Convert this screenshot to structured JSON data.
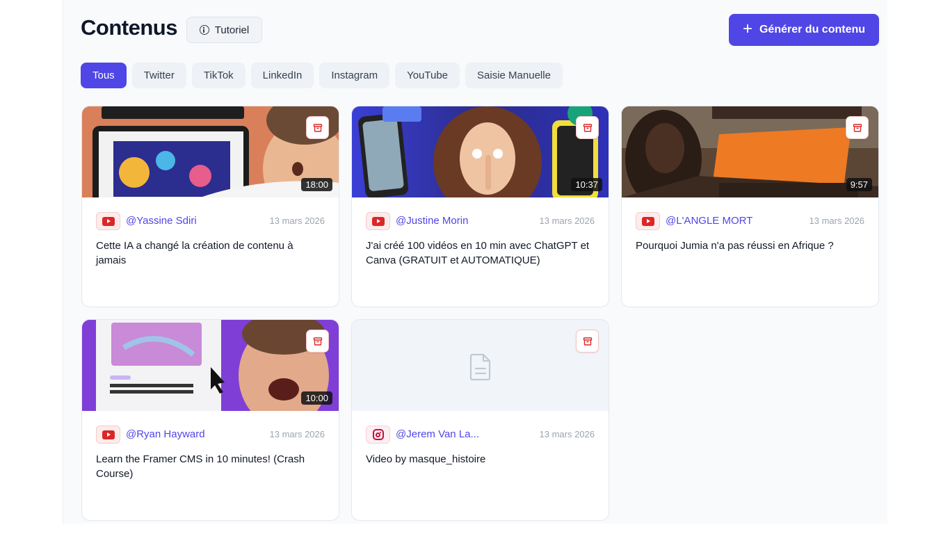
{
  "header": {
    "title": "Contenus",
    "tutorial_label": "Tutoriel",
    "generate_label": "Générer du contenu"
  },
  "filters": [
    {
      "label": "Tous",
      "active": true
    },
    {
      "label": "Twitter",
      "active": false
    },
    {
      "label": "TikTok",
      "active": false
    },
    {
      "label": "LinkedIn",
      "active": false
    },
    {
      "label": "Instagram",
      "active": false
    },
    {
      "label": "YouTube",
      "active": false
    },
    {
      "label": "Saisie Manuelle",
      "active": false
    }
  ],
  "cards": [
    {
      "platform": "youtube",
      "author": "@Yassine Sdiri",
      "date": "13 mars 2026",
      "duration": "18:00",
      "title": "Cette IA a changé la création de contenu à jamais"
    },
    {
      "platform": "youtube",
      "author": "@Justine Morin",
      "date": "13 mars 2026",
      "duration": "10:37",
      "title": "J'ai créé 100 vidéos en 10 min avec ChatGPT et Canva (GRATUIT et AUTOMATIQUE)"
    },
    {
      "platform": "youtube",
      "author": "@L'ANGLE MORT",
      "date": "13 mars 2026",
      "duration": "9:57",
      "title": "Pourquoi Jumia n'a pas réussi en Afrique ?"
    },
    {
      "platform": "youtube",
      "author": "@Ryan Hayward",
      "date": "13 mars 2026",
      "duration": "10:00",
      "title": "Learn the Framer CMS in 10 minutes! (Crash Course)"
    },
    {
      "platform": "instagram",
      "author": "@Jerem Van La...",
      "date": "13 mars 2026",
      "duration": "",
      "title": "Video by masque_histoire"
    }
  ],
  "colors": {
    "accent": "#4f46e5",
    "youtube_red": "#dc2626",
    "instagram": "#be123c",
    "archive_red": "#dc2626"
  },
  "icons": {
    "tutorial": "info-icon",
    "generate": "plus-icon",
    "archive": "archive-icon",
    "placeholder": "document-icon"
  }
}
